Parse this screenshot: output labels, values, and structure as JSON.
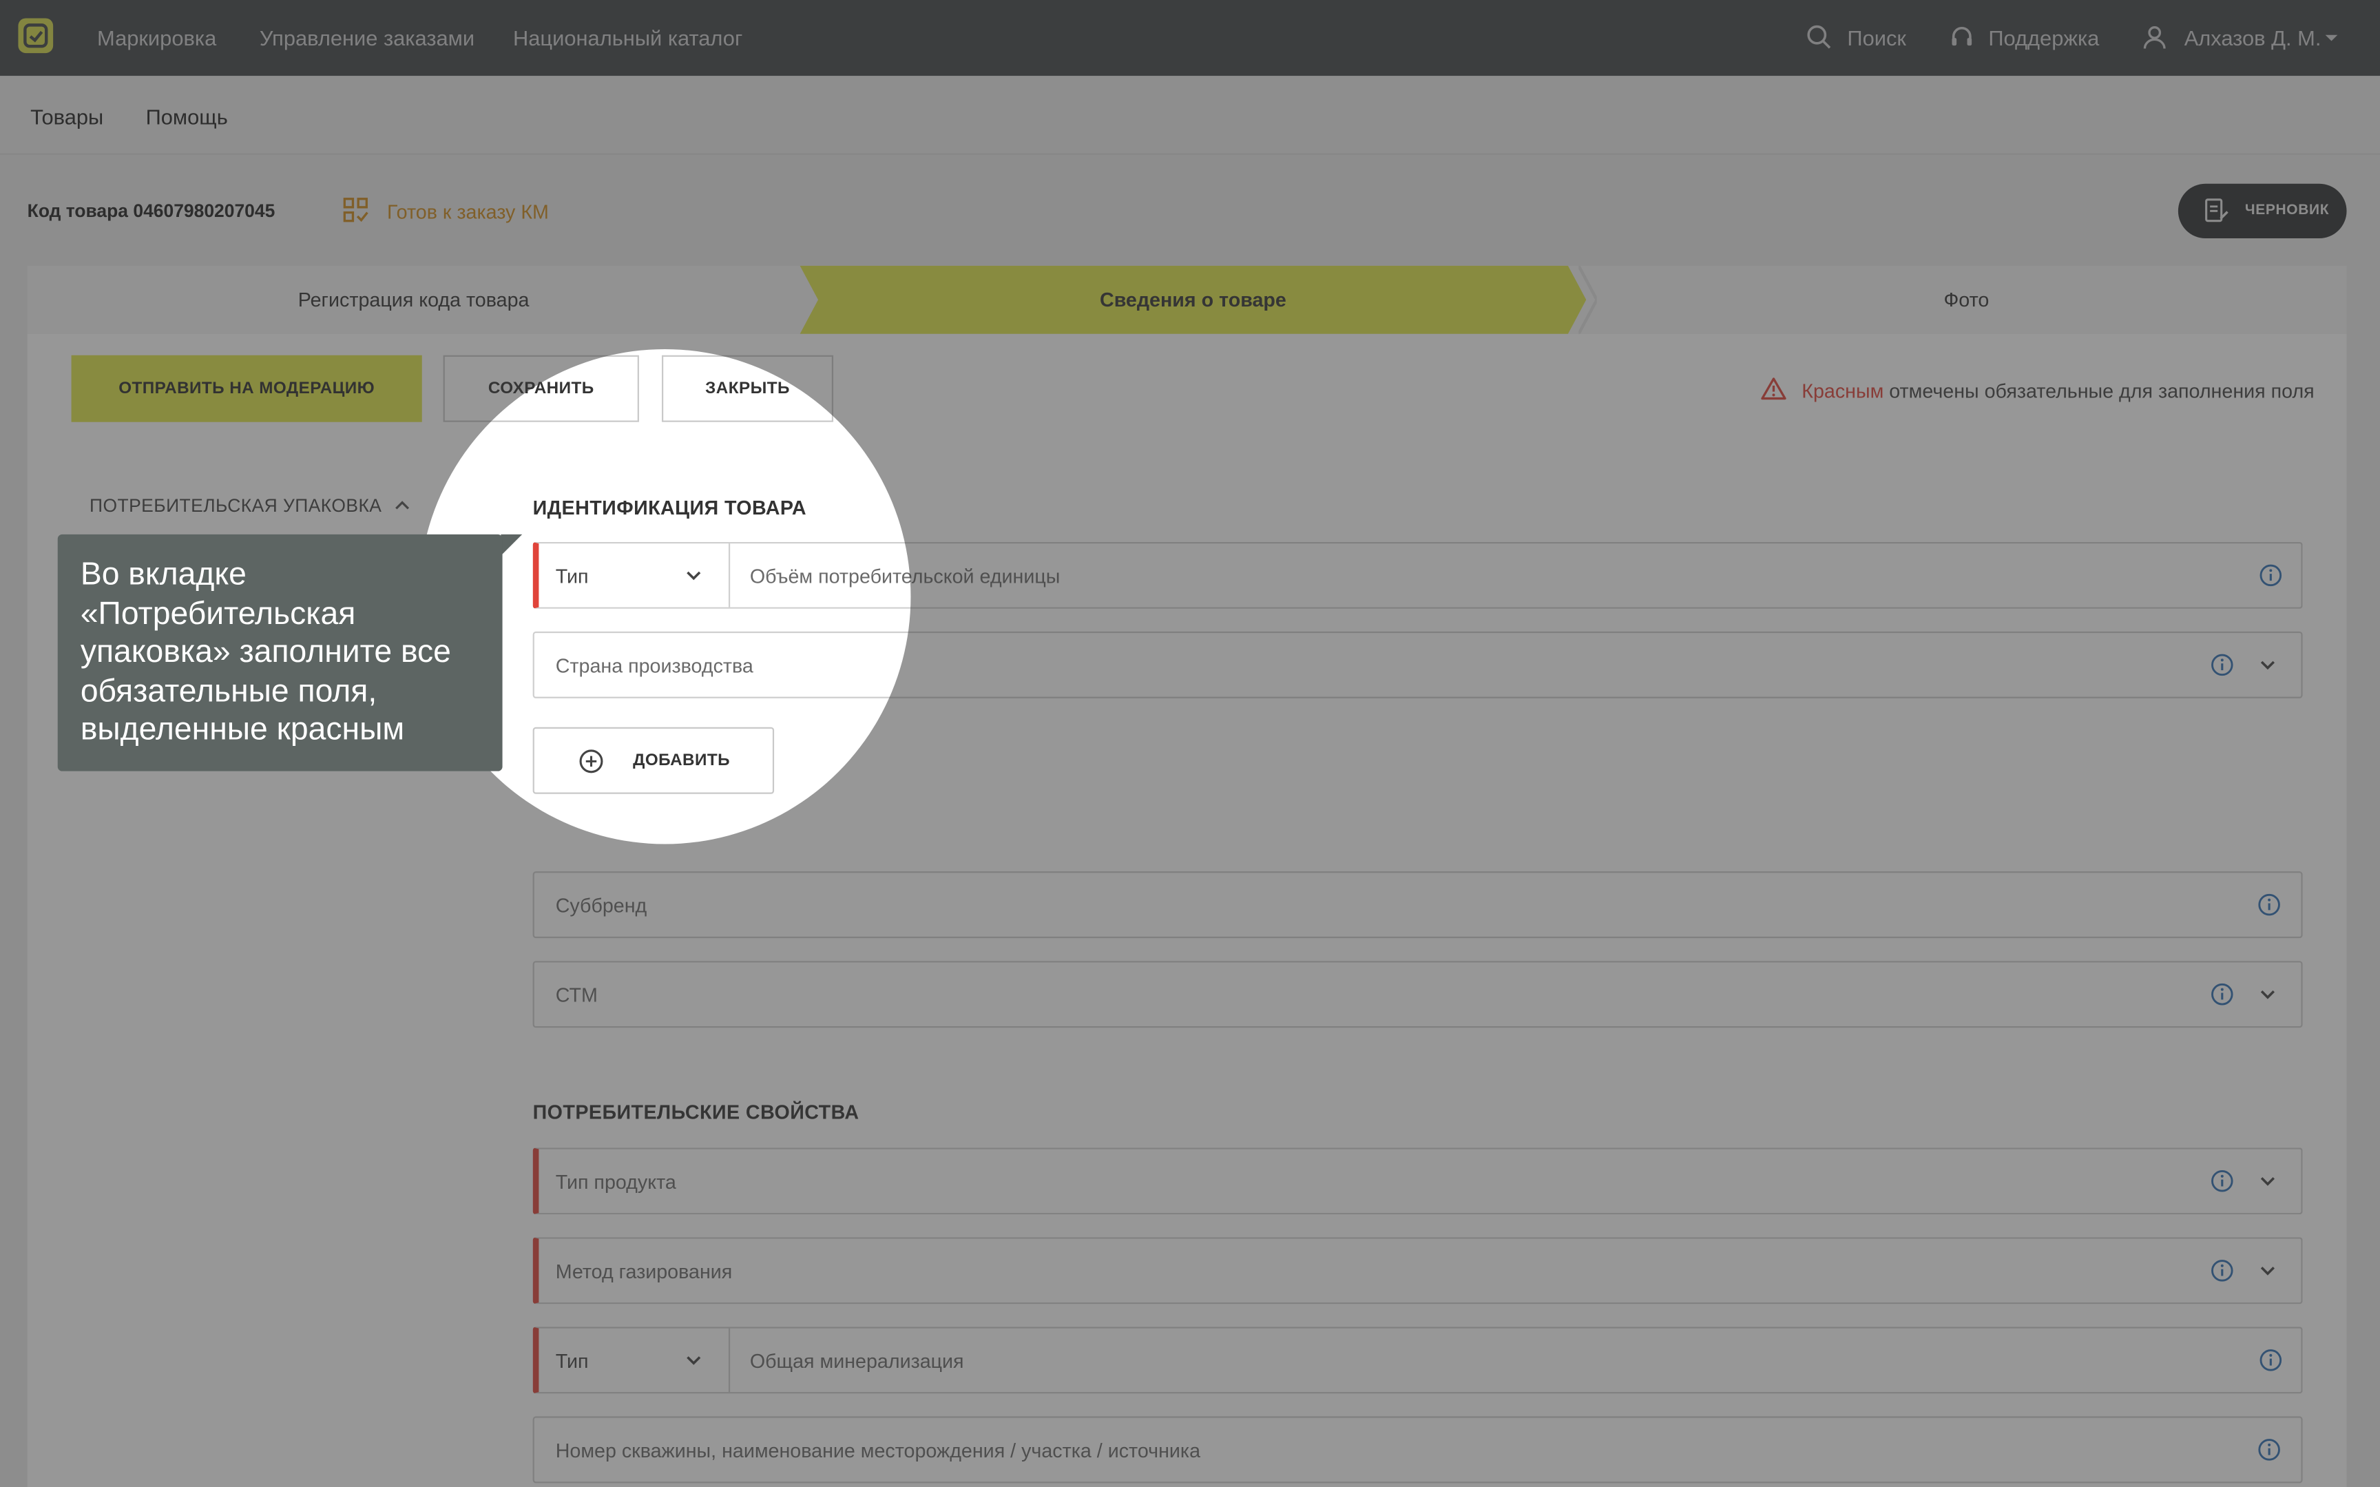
{
  "topbar": {
    "nav": [
      "Маркировка",
      "Управление заказами",
      "Национальный каталог"
    ],
    "search_label": "Поиск",
    "support_label": "Поддержка",
    "user_label": "Алхазов Д. М."
  },
  "subnav": {
    "items": [
      "Товары",
      "Помощь"
    ]
  },
  "product": {
    "code_label": "Код товара 04607980207045",
    "status": "Готов к заказу КМ",
    "draft_label": "ЧЕРНОВИК"
  },
  "stepper": {
    "steps": [
      "Регистрация кода товара",
      "Сведения о товаре",
      "Фото"
    ],
    "active_index": 1
  },
  "actions": {
    "submit": "ОТПРАВИТЬ НА МОДЕРАЦИЮ",
    "save": "СОХРАНИТЬ",
    "close": "ЗАКРЫТЬ"
  },
  "hint": {
    "red_word": "Красным",
    "rest": " отмечены обязательные для заполнения поля"
  },
  "sidebar": {
    "item": "ПОТРЕБИТЕЛЬСКАЯ УПАКОВКА"
  },
  "sections": {
    "identification": "ИДЕНТИФИКАЦИЯ ТОВАРА",
    "consumer_props": "ПОТРЕБИТЕЛЬСКИЕ СВОЙСТВА"
  },
  "fields": {
    "type_label": "Тип",
    "volume": "Объём потребительской единицы",
    "country": "Страна производства",
    "add": "ДОБАВИТЬ",
    "subbrand": "Суббренд",
    "stm": "СТМ",
    "product_type": "Тип продукта",
    "carbonation": "Метод газирования",
    "mineralization": "Общая минерализация",
    "well": "Номер скважины, наименование месторождения / участка / источника"
  },
  "tooltip": {
    "text": "Во вкладке «Потребительская упаковка» заполните все обязательные поля, выделенные красным"
  },
  "colors": {
    "accent": "#dfe54a",
    "required": "#e0443a",
    "status": "#d08a1a"
  }
}
